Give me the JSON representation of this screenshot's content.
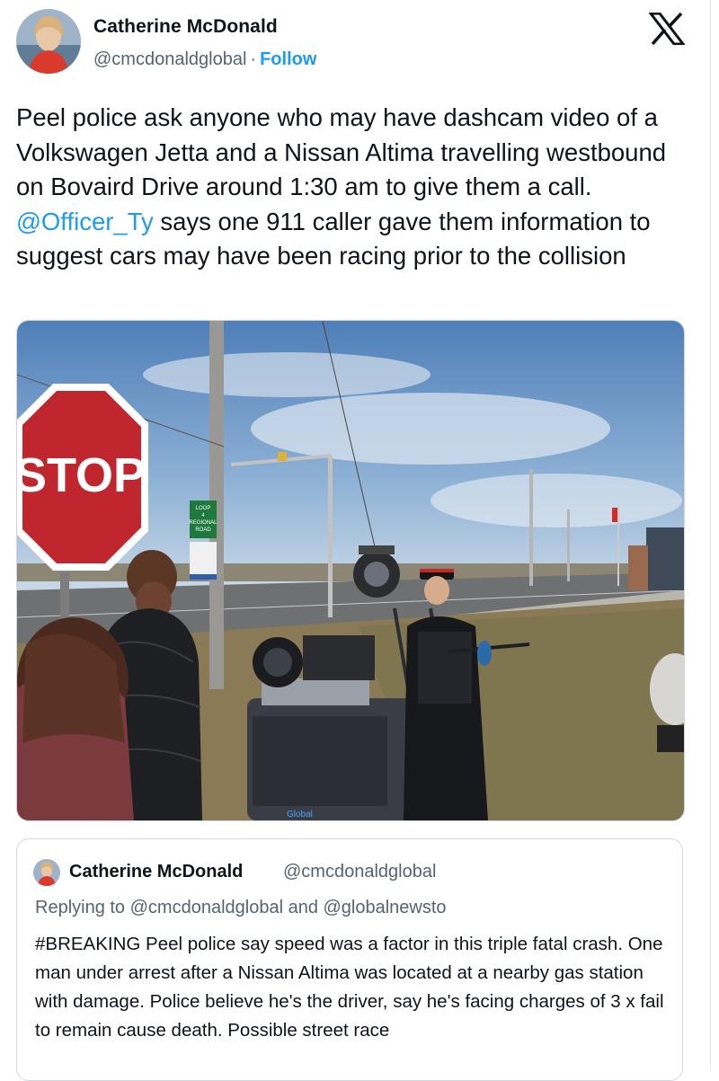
{
  "author": {
    "name": "Catherine McDonald",
    "handle": "@cmcdonaldglobal",
    "separator": "·",
    "follow_label": "Follow"
  },
  "platform_icon": "x-logo-icon",
  "tweet": {
    "text_part1": "Peel police ask anyone who may have dashcam video of a Volkswagen Jetta and a Nissan Altima travelling westbound on Bovaird Drive around 1:30 am to give them a call. ",
    "mention": "@Officer_Ty",
    "text_part2": " says one 911 caller gave them information to suggest cars may have been racing prior to the collision"
  },
  "photo": {
    "stop_sign_text": "STOP",
    "road_sign_lines": [
      "LOOP",
      "4",
      "REGIONAL",
      "ROAD"
    ],
    "camera_brand": "Global"
  },
  "quoted_tweet": {
    "name": "Catherine McDonald",
    "handle": "@cmcdonaldglobal",
    "reply_context": "Replying to @cmcdonaldglobal and @globalnewsto",
    "text": "#BREAKING Peel police say speed was a factor in this triple fatal crash. One man under arrest after a Nissan Altima was located at a nearby gas station with damage. Police believe he's the driver, say he's facing charges of 3 x fail to remain cause death. Possible street race"
  },
  "colors": {
    "link": "#1d9bf0",
    "secondary_text": "#536471",
    "primary_text": "#0f1419",
    "border": "#cfd9de"
  }
}
